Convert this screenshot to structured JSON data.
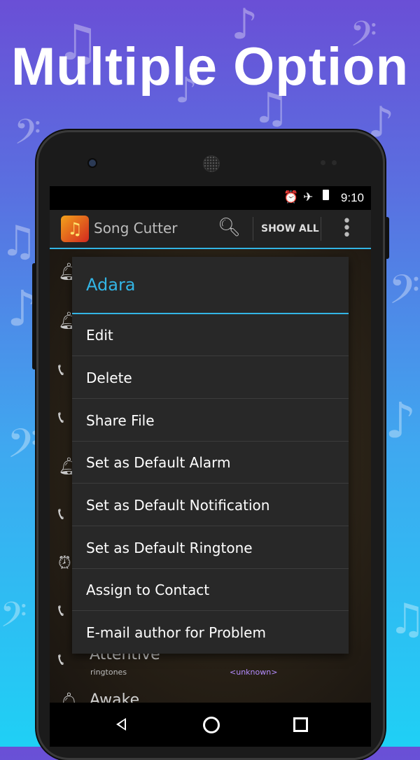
{
  "banner": {
    "title": "Multiple Option"
  },
  "status_bar": {
    "time": "9:10",
    "icons": [
      "alarm-icon",
      "airplane-icon",
      "battery-icon"
    ]
  },
  "action_bar": {
    "app_title": "Song Cutter",
    "show_all_label": "SHOW ALL",
    "icons": [
      "app-icon",
      "search-icon",
      "overflow-menu-icon"
    ]
  },
  "list": {
    "visible_rows": [
      {
        "title": "Attentive",
        "subtitle": "ringtones",
        "meta": "<unknown>"
      },
      {
        "title": "Awake",
        "subtitle": "",
        "meta": ""
      }
    ]
  },
  "dialog": {
    "title": "Adara",
    "items": [
      "Edit",
      "Delete",
      "Share File",
      "Set as Default Alarm",
      "Set as Default Notification",
      "Set as Default Ringtone",
      "Assign to Contact",
      "E-mail author for Problem"
    ]
  },
  "nav_bar": {
    "icons": [
      "back-icon",
      "home-icon",
      "recents-icon"
    ]
  },
  "colors": {
    "accent": "#33b5e5",
    "dialog_bg": "#282828",
    "meta_text": "#b58cff"
  }
}
